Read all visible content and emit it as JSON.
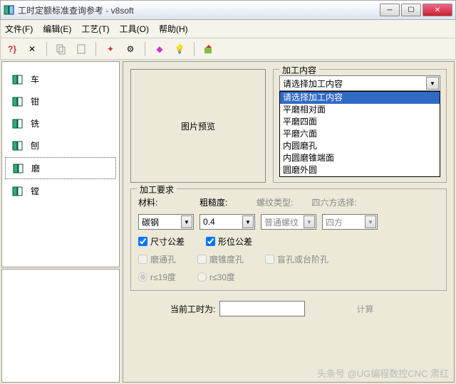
{
  "window": {
    "title": "工时定额标准查询参考 - v8soft"
  },
  "menu": {
    "file": "文件(F)",
    "edit": "编辑(E)",
    "craft": "工艺(T)",
    "tool": "工具(O)",
    "help": "帮助(H)"
  },
  "tree": {
    "items": [
      {
        "label": "车"
      },
      {
        "label": "钳"
      },
      {
        "label": "铣"
      },
      {
        "label": "刨"
      },
      {
        "label": "磨"
      },
      {
        "label": "镗"
      }
    ]
  },
  "preview": {
    "label": "图片预览"
  },
  "content": {
    "legend": "加工内容",
    "selected": "请选择加工内容",
    "options": [
      "请选择加工内容",
      "平磨相对面",
      "平磨四面",
      "平磨六面",
      "内圆磨孔",
      "内圆磨锥端面",
      "圆磨外圆"
    ]
  },
  "req": {
    "legend": "加工要求",
    "material_label": "材料:",
    "material_value": "碳钢",
    "rough_label": "粗糙度:",
    "rough_value": "0.4",
    "thread_label": "螺纹类型:",
    "thread_value": "普通螺纹",
    "square_label": "四六方选择:",
    "square_value": "四方",
    "chk_size": "尺寸公差",
    "chk_pos": "形位公差",
    "chk_through": "磨通孔",
    "chk_taper": "磨锥度孔",
    "chk_blind": "盲孔或台阶孔",
    "rad19": "r≤19度",
    "rad30": "r≤30度"
  },
  "bottom": {
    "current_label": "当前工时为:",
    "calc_label": "计算"
  },
  "watermark": "头条号 @UG编程数控CNC 肃红"
}
